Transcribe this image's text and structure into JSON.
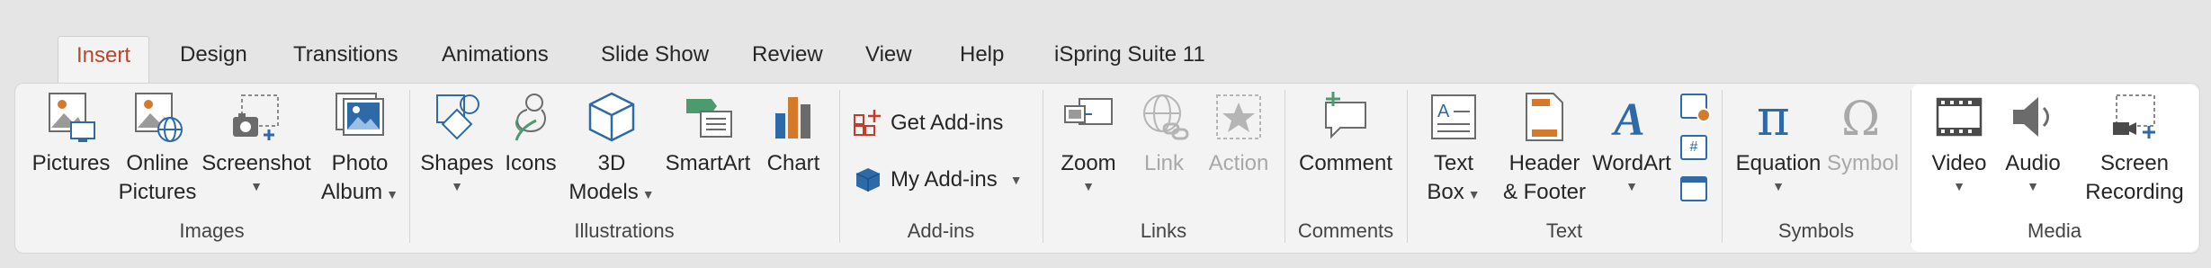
{
  "tabs": [
    {
      "label": "Insert",
      "active": true
    },
    {
      "label": "Design"
    },
    {
      "label": "Transitions"
    },
    {
      "label": "Animations"
    },
    {
      "label": "Slide Show"
    },
    {
      "label": "Review"
    },
    {
      "label": "View"
    },
    {
      "label": "Help"
    },
    {
      "label": "iSpring Suite 11"
    }
  ],
  "groups": {
    "images": {
      "label": "Images",
      "pictures": "Pictures",
      "online_pictures_1": "Online",
      "online_pictures_2": "Pictures",
      "screenshot": "Screenshot",
      "photo_album_1": "Photo",
      "photo_album_2": "Album"
    },
    "illustrations": {
      "label": "Illustrations",
      "shapes": "Shapes",
      "icons": "Icons",
      "models_1": "3D",
      "models_2": "Models",
      "smartart": "SmartArt",
      "chart": "Chart"
    },
    "addins": {
      "label": "Add-ins",
      "get_addins": "Get Add-ins",
      "my_addins": "My Add-ins"
    },
    "links": {
      "label": "Links",
      "zoom": "Zoom",
      "link": "Link",
      "action": "Action"
    },
    "comments": {
      "label": "Comments",
      "comment": "Comment"
    },
    "text": {
      "label": "Text",
      "text_box_1": "Text",
      "text_box_2": "Box",
      "header_footer_1": "Header",
      "header_footer_2": "& Footer",
      "wordart": "WordArt"
    },
    "symbols": {
      "label": "Symbols",
      "equation": "Equation",
      "symbol": "Symbol"
    },
    "media": {
      "label": "Media",
      "video": "Video",
      "audio": "Audio",
      "screen_recording_1": "Screen",
      "screen_recording_2": "Recording"
    }
  },
  "colors": {
    "accent": "#b7472a",
    "icon_blue": "#2e6aa8",
    "icon_gray": "#6b6b6b",
    "icon_orange": "#d47a2c",
    "icon_green": "#4c9a6e"
  }
}
